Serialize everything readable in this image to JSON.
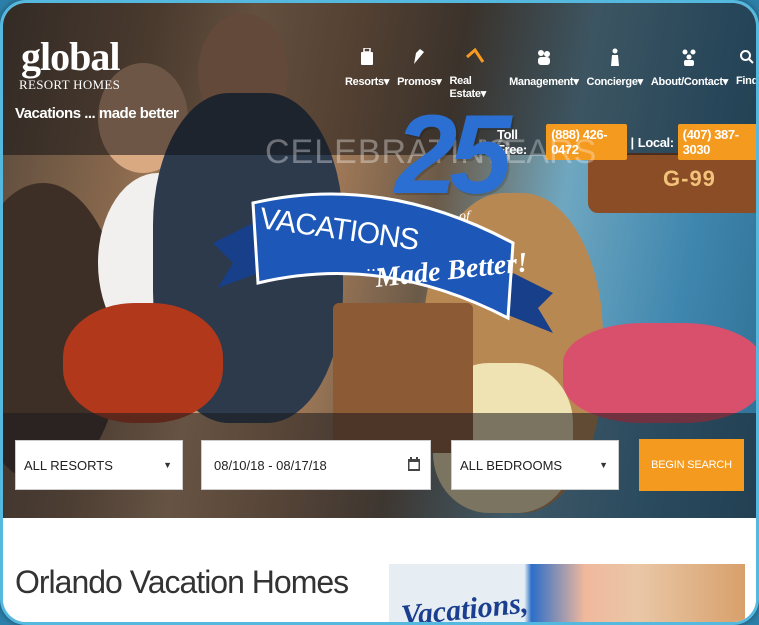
{
  "brand": {
    "logo_word": "global",
    "logo_sub": "RESORT HOMES",
    "tagline": "Vacations ... made better"
  },
  "nav": [
    {
      "label": "Resorts",
      "caret": "▾",
      "icon": "luggage-icon"
    },
    {
      "label": "Promos",
      "caret": "▾",
      "icon": "tag-icon"
    },
    {
      "label": "Real Estate",
      "caret": "▾",
      "icon": "house-icon"
    },
    {
      "label": "Management",
      "caret": "▾",
      "icon": "people-icon"
    },
    {
      "label": "Concierge",
      "caret": "▾",
      "icon": "concierge-icon"
    },
    {
      "label": "About/Contact",
      "caret": "▾",
      "icon": "group-icon"
    },
    {
      "label": "Find",
      "caret": "",
      "icon": "search-icon"
    }
  ],
  "contact": {
    "toll_free_label": "Toll Free:",
    "toll_free": "(888) 426-0472",
    "separator": "|",
    "local_label": "Local:",
    "local": "(407) 387-3030"
  },
  "banner": {
    "celebrating": "CELEBRATING",
    "years_number": "25",
    "of": "of",
    "years": "YEARS",
    "ribbon_line1": "VACATIONS",
    "ribbon_dots": "...",
    "ribbon_line2": "Made Better!"
  },
  "boat_label": "G-99",
  "search": {
    "resort_value": "ALL RESORTS",
    "dates_value": "08/10/18 - 08/17/18",
    "bedrooms_value": "ALL BEDROOMS",
    "button_label": "BEGIN SEARCH"
  },
  "main": {
    "title": "Orlando Vacation Homes",
    "promo_text": "Vacations,"
  },
  "colors": {
    "accent": "#f49a1e",
    "ribbon_blue": "#1d58b8",
    "number_blue": "#2a6fd1",
    "frame_blue": "#55b8df"
  }
}
